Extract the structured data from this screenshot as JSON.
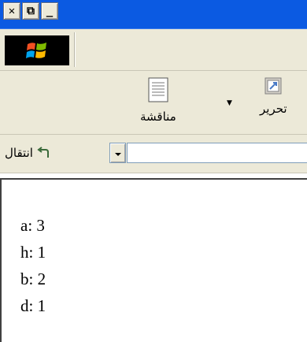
{
  "window": {
    "buttons": [
      {
        "name": "close-button",
        "glyph": "✕"
      },
      {
        "name": "restore-button",
        "glyph": "⧉"
      },
      {
        "name": "minimize-button",
        "glyph": "_"
      }
    ]
  },
  "toolbar": {
    "discuss_label": "مناقشة",
    "edit_label": "تحرير"
  },
  "address": {
    "goto_label": "انتقال",
    "value": ""
  },
  "content": {
    "lines": [
      "a: 3",
      "h: 1",
      "b: 2",
      "d: 1"
    ]
  },
  "colors": {
    "titlebar": "#0b5ae2",
    "chrome": "#ece9d8"
  },
  "icons": {
    "logo": "windows-logo-icon",
    "discuss": "discuss-document-icon",
    "edit": "edit-icon",
    "goto": "goto-arrow-icon",
    "dropdown": "chevron-down-icon"
  }
}
